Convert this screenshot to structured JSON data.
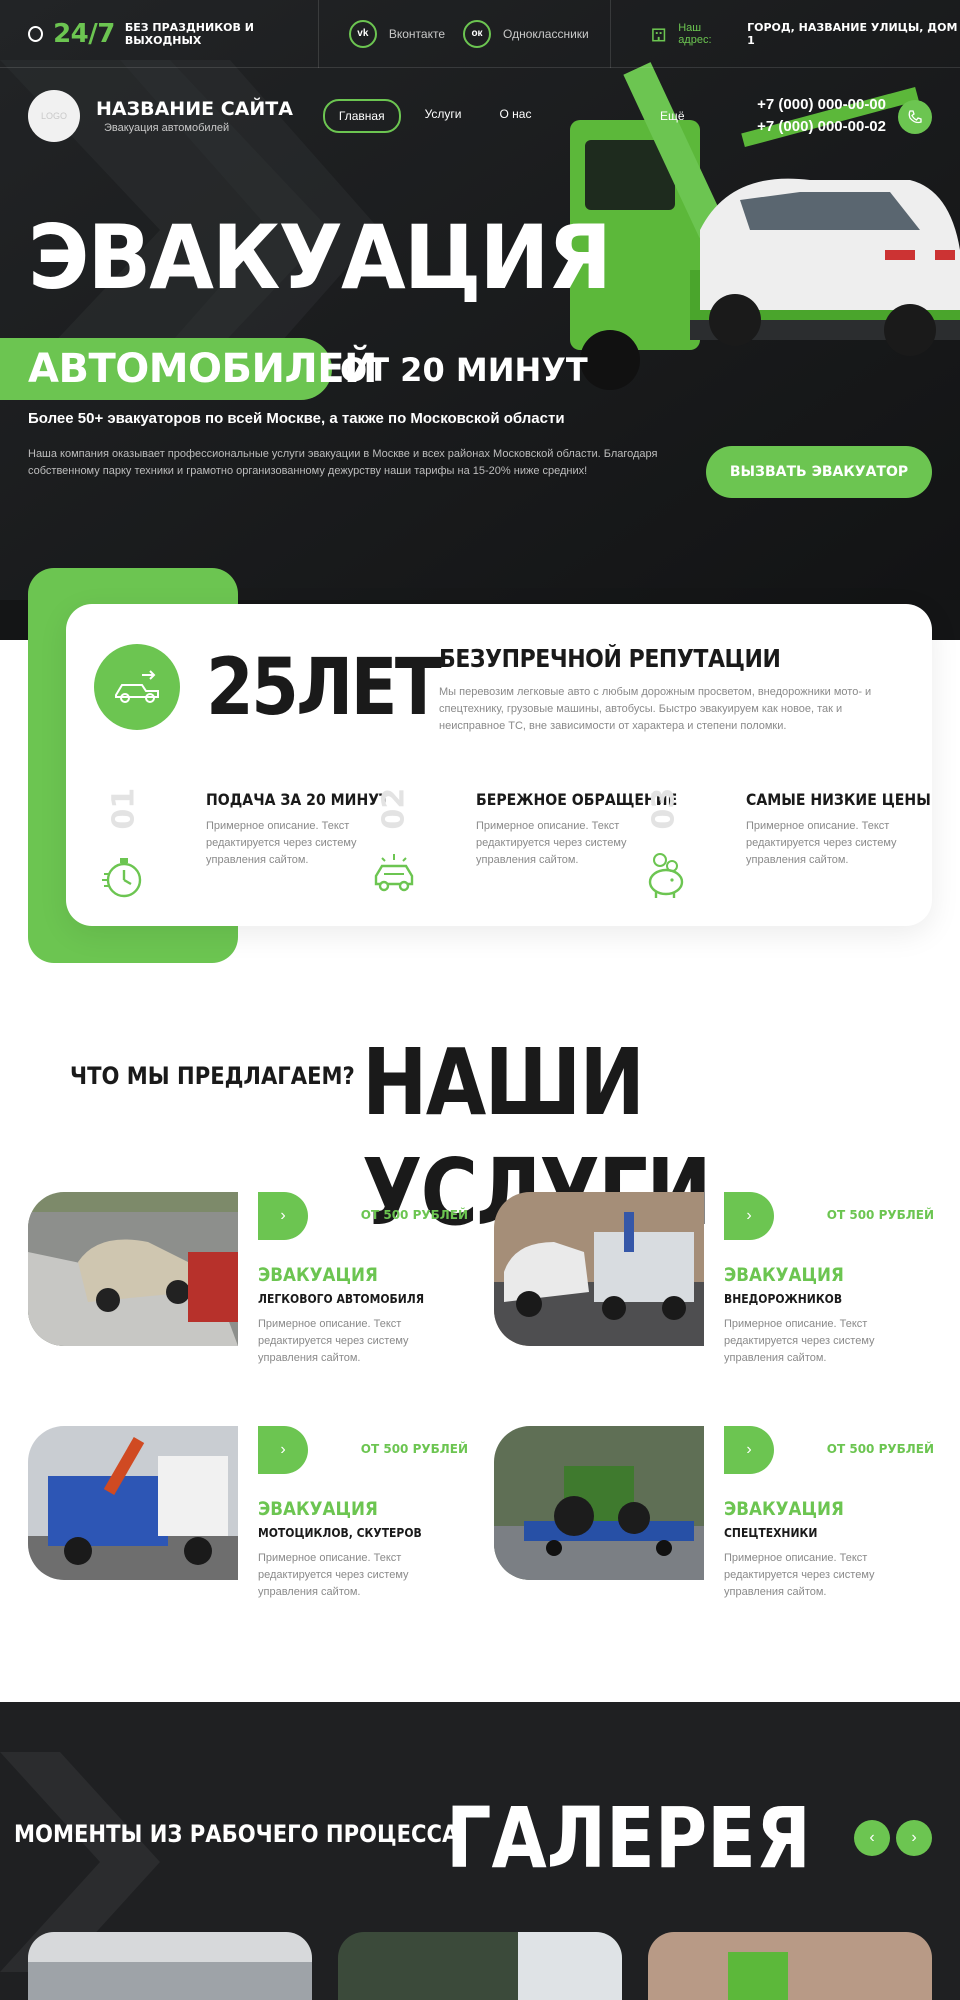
{
  "topbar": {
    "hours": "24/7",
    "hours_note": "БЕЗ ПРАЗДНИКОВ И ВЫХОДНЫХ",
    "social": [
      {
        "icon": "vk-icon",
        "glyph": "vk",
        "label": "Вконтакте"
      },
      {
        "icon": "ok-icon",
        "glyph": "ок",
        "label": "Одноклассники"
      }
    ],
    "address_label": "Наш адрес:",
    "address": "ГОРОД, НАЗВАНИЕ УЛИЦЫ, ДОМ 1"
  },
  "header": {
    "logo_text": "LOGO",
    "site_name": "НАЗВАНИЕ САЙТА",
    "site_tagline": "Эвакуация автомобилей",
    "menu": [
      "Главная",
      "Услуги",
      "О нас"
    ],
    "more": "Ещё",
    "phones": [
      "+7 (000) 000-00-00",
      "+7 (000) 000-00-02"
    ]
  },
  "hero": {
    "title": "ЭВАКУАЦИЯ",
    "title_accent": "АВТОМОБИЛЕЙ",
    "title_rest": "ОТ 20 МИНУТ",
    "subtitle": "Более 50+ эвакуаторов по всей Москве, а также по Московской области",
    "description": "Наша компания оказывает профессиональные услуги эвакуации в Москве и всех районах Московской области. Благодаря собственному парку техники и грамотно организованному дежурству наши тарифы на 15-20% ниже средних!",
    "cta": "ВЫЗВАТЬ ЭВАКУАТОР"
  },
  "stats": {
    "years": "25ЛЕТ",
    "reputation_title": "БЕЗУПРЕЧНОЙ РЕПУТАЦИИ",
    "reputation_text": "Мы перевозим легковые авто с любым дорожным просветом, внедорожники мото- и спецтехнику, грузовые машины, автобусы. Быстро эвакуируем как новое, так и неисправное ТС, вне зависимости от характера и степени поломки.",
    "features": [
      {
        "num": "01",
        "title": "ПОДАЧА ЗА 20 МИНУТ",
        "text": "Примерное описание. Текст редактируется через систему управления сайтом.",
        "icon": "stopwatch-icon"
      },
      {
        "num": "02",
        "title": "БЕРЕЖНОЕ ОБРАЩЕНИЕ",
        "text": "Примерное описание. Текст редактируется через систему управления сайтом.",
        "icon": "car-icon"
      },
      {
        "num": "03",
        "title": "САМЫЕ НИЗКИЕ ЦЕНЫ",
        "text": "Примерное описание. Текст редактируется через систему управления сайтом.",
        "icon": "piggy-bank-icon"
      }
    ]
  },
  "services": {
    "kicker": "ЧТО МЫ ПРЕДЛАГАЕМ?",
    "title": "НАШИ УСЛУГИ",
    "items": [
      {
        "price": "ОТ 500 РУБЛЕЙ",
        "title": "ЭВАКУАЦИЯ",
        "subtitle": "ЛЕГКОВОГО АВТОМОБИЛЯ",
        "text": "Примерное описание. Текст редактируется через систему управления сайтом."
      },
      {
        "price": "ОТ 500 РУБЛЕЙ",
        "title": "ЭВАКУАЦИЯ",
        "subtitle": "ВНЕДОРОЖНИКОВ",
        "text": "Примерное описание. Текст редактируется через систему управления сайтом."
      },
      {
        "price": "ОТ 500 РУБЛЕЙ",
        "title": "ЭВАКУАЦИЯ",
        "subtitle": "МОТОЦИКЛОВ, СКУТЕРОВ",
        "text": "Примерное описание. Текст редактируется через систему управления сайтом."
      },
      {
        "price": "ОТ 500 РУБЛЕЙ",
        "title": "ЭВАКУАЦИЯ",
        "subtitle": "СПЕЦТЕХНИКИ",
        "text": "Примерное описание. Текст редактируется через систему управления сайтом."
      }
    ]
  },
  "gallery": {
    "kicker": "МОМЕНТЫ ИЗ РАБОЧЕГО ПРОЦЕССА",
    "title": "ГАЛЕРЕЯ"
  },
  "colors": {
    "accent": "#6cc551",
    "dark": "#1b1d1f",
    "muted": "#8a8a8a"
  }
}
